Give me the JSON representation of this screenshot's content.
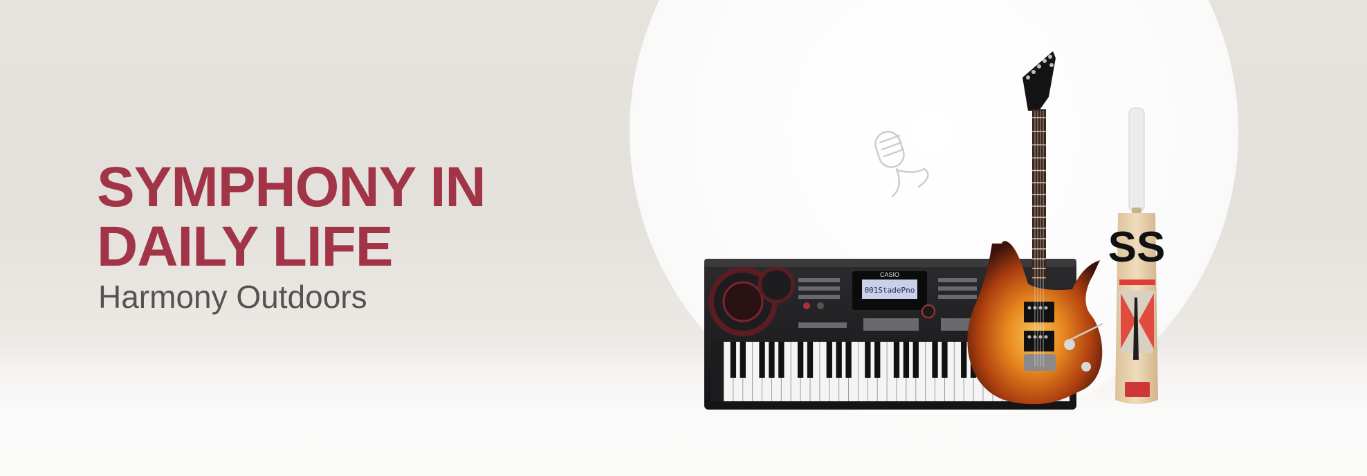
{
  "banner": {
    "headline_line1": "SYMPHONY IN",
    "headline_line2": "DAILY LIFE",
    "subhead": "Harmony Outdoors"
  },
  "products": [
    {
      "name": "keyboard",
      "brand": "CASIO",
      "display_text": "001StadePno"
    },
    {
      "name": "electric-guitar"
    },
    {
      "name": "cricket-bat",
      "brand": "SS"
    }
  ],
  "icons": [
    {
      "name": "microphone-icon"
    }
  ],
  "colors": {
    "headline": "#a23447",
    "subhead": "#555250",
    "background": "#e6e2dd",
    "spotlight": "#ffffff"
  }
}
